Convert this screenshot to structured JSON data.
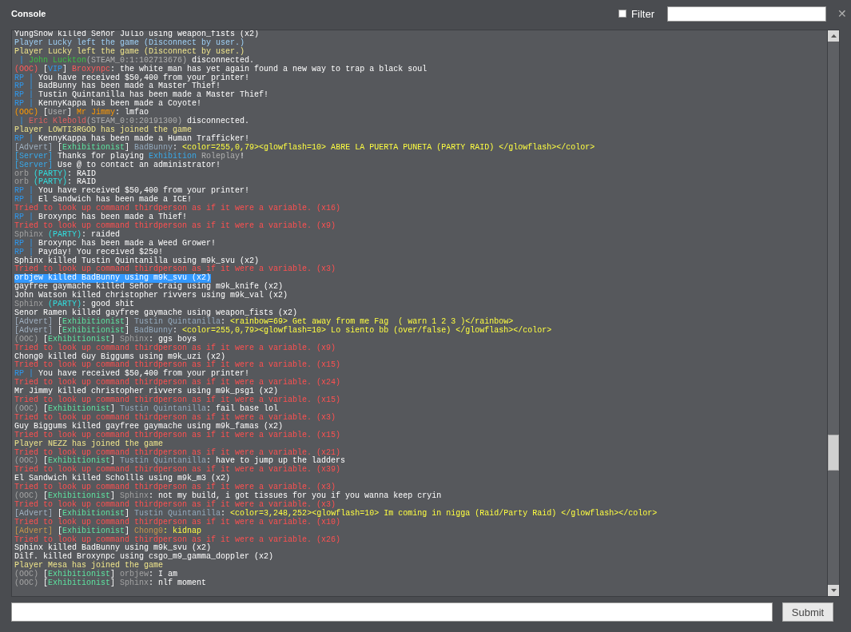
{
  "window": {
    "title": "Console",
    "close": "✕"
  },
  "filter": {
    "label": "Filter",
    "checked": false
  },
  "lines": [
    {
      "selected": false,
      "parts": [
        {
          "text": "YungSnow killed Señor Julio using weapon_fists (x2)",
          "kind": "text"
        }
      ]
    },
    {
      "selected": false,
      "parts": [
        {
          "text": "Player Lucky left the game (Disconnect by user.)",
          "kind": "left"
        }
      ]
    },
    {
      "selected": false,
      "parts": [
        {
          "text": "Player Lucky left the game (Disconnect by user.)",
          "kind": "joined"
        }
      ]
    },
    {
      "selected": false,
      "parts": [
        {
          "text": " | ",
          "kind": "rp"
        },
        {
          "text": "John Luckton",
          "kind": "player"
        },
        {
          "text": "(STEAM_0:1:102713676)",
          "kind": "id"
        },
        {
          "text": " disconnected.",
          "kind": "text"
        }
      ]
    },
    {
      "selected": false,
      "parts": [
        {
          "text": "(OOC) ",
          "kind": "ooc"
        },
        {
          "text": "[",
          "kind": "text"
        },
        {
          "text": "VIP",
          "kind": "rp"
        },
        {
          "text": "] ",
          "kind": "text"
        },
        {
          "text": "Broxynpc",
          "kind": "ooc"
        },
        {
          "text": ": the white man has yet again found a new way to trap a black soul",
          "kind": "text"
        }
      ]
    },
    {
      "selected": false,
      "parts": [
        {
          "text": "RP | ",
          "kind": "rp"
        },
        {
          "text": "You have received $50,400 from your printer!",
          "kind": "text"
        }
      ]
    },
    {
      "selected": false,
      "parts": [
        {
          "text": "RP | ",
          "kind": "rp"
        },
        {
          "text": "BadBunny has been made a Master Thief!",
          "kind": "text"
        }
      ]
    },
    {
      "selected": false,
      "parts": [
        {
          "text": "RP | ",
          "kind": "rp"
        },
        {
          "text": "Tustin Quintanilla has been made a Master Thief!",
          "kind": "text"
        }
      ]
    },
    {
      "selected": false,
      "parts": [
        {
          "text": "RP | ",
          "kind": "rp"
        },
        {
          "text": "KennyKappa has been made a Coyote!",
          "kind": "text"
        }
      ]
    },
    {
      "selected": false,
      "parts": [
        {
          "text": "(OOC) ",
          "kind": "user"
        },
        {
          "text": "[",
          "kind": "text"
        },
        {
          "text": "User",
          "kind": "id"
        },
        {
          "text": "] ",
          "kind": "text"
        },
        {
          "text": "Mr Jimmy",
          "kind": "user"
        },
        {
          "text": ": lmfao",
          "kind": "text"
        }
      ]
    },
    {
      "selected": false,
      "parts": [
        {
          "text": " | ",
          "kind": "rp"
        },
        {
          "text": "Eric Klebold",
          "kind": "leaver"
        },
        {
          "text": "(STEAM_0:0:20191300)",
          "kind": "id"
        },
        {
          "text": " disconnected.",
          "kind": "text"
        }
      ]
    },
    {
      "selected": false,
      "parts": [
        {
          "text": "Player LOWTI3RGOD has joined the game",
          "kind": "joined"
        }
      ]
    },
    {
      "selected": false,
      "parts": [
        {
          "text": "RP | ",
          "kind": "rp"
        },
        {
          "text": "KennyKappa has been made a Human Trafficker!",
          "kind": "text"
        }
      ]
    },
    {
      "selected": false,
      "parts": [
        {
          "text": "[Advert] ",
          "kind": "advert"
        },
        {
          "text": "[",
          "kind": "text"
        },
        {
          "text": "Exhibitionist",
          "kind": "group"
        },
        {
          "text": "] ",
          "kind": "text"
        },
        {
          "text": "BadBunny",
          "kind": "member"
        },
        {
          "text": ": ",
          "kind": "text"
        },
        {
          "text": "<color=255,0,79><glowflash=10> ABRE LA PUERTA PUNETA (PARTY RAID) </glowflash></color>",
          "kind": "markup"
        }
      ]
    },
    {
      "selected": false,
      "parts": [
        {
          "text": "[Server] ",
          "kind": "server"
        },
        {
          "text": "Thanks for playing ",
          "kind": "text"
        },
        {
          "text": "Exhibition",
          "kind": "server"
        },
        {
          "text": " Roleplay",
          "kind": "id"
        },
        {
          "text": "!",
          "kind": "text"
        }
      ]
    },
    {
      "selected": false,
      "parts": [
        {
          "text": "[Server] ",
          "kind": "server"
        },
        {
          "text": "Use @ to contact an administrator!",
          "kind": "text"
        }
      ]
    },
    {
      "selected": false,
      "parts": [
        {
          "text": "orb ",
          "kind": "guest"
        },
        {
          "text": "(PARTY)",
          "kind": "party"
        },
        {
          "text": ": RAID",
          "kind": "text"
        }
      ]
    },
    {
      "selected": false,
      "parts": [
        {
          "text": "orb ",
          "kind": "guest"
        },
        {
          "text": "(PARTY)",
          "kind": "party"
        },
        {
          "text": ": RAID",
          "kind": "text"
        }
      ]
    },
    {
      "selected": false,
      "parts": [
        {
          "text": "RP | ",
          "kind": "rp"
        },
        {
          "text": "You have received $50,400 from your printer!",
          "kind": "text"
        }
      ]
    },
    {
      "selected": false,
      "parts": [
        {
          "text": "RP | ",
          "kind": "rp"
        },
        {
          "text": "El Sandwich has been made a ICE!",
          "kind": "text"
        }
      ]
    },
    {
      "selected": false,
      "parts": [
        {
          "text": "Tried to look up command thirdperson as if it were a variable. (x16)",
          "kind": "error"
        }
      ]
    },
    {
      "selected": false,
      "parts": [
        {
          "text": "RP | ",
          "kind": "rp"
        },
        {
          "text": "Broxynpc has been made a Thief!",
          "kind": "text"
        }
      ]
    },
    {
      "selected": false,
      "parts": [
        {
          "text": "Tried to look up command thirdperson as if it were a variable. (x9)",
          "kind": "error"
        }
      ]
    },
    {
      "selected": false,
      "parts": [
        {
          "text": "Sphinx ",
          "kind": "guest"
        },
        {
          "text": "(PARTY)",
          "kind": "party"
        },
        {
          "text": ": raided",
          "kind": "text"
        }
      ]
    },
    {
      "selected": false,
      "parts": [
        {
          "text": "RP | ",
          "kind": "rp"
        },
        {
          "text": "Broxynpc has been made a Weed Grower!",
          "kind": "text"
        }
      ]
    },
    {
      "selected": false,
      "parts": [
        {
          "text": "RP | ",
          "kind": "rp"
        },
        {
          "text": "Payday! You received $250!",
          "kind": "text"
        }
      ]
    },
    {
      "selected": false,
      "parts": [
        {
          "text": "Sphinx killed Tustin Quintanilla using m9k_svu (x2)",
          "kind": "text"
        }
      ]
    },
    {
      "selected": false,
      "parts": [
        {
          "text": "Tried to look up command thirdperson as if it were a variable. (x3)",
          "kind": "error"
        }
      ]
    },
    {
      "selected": true,
      "parts": [
        {
          "text": "orbjew killed BadBunny using m9k_svu (x2)",
          "kind": "text"
        }
      ]
    },
    {
      "selected": false,
      "parts": [
        {
          "text": "gayfree gaymache killed Señor Craig using m9k_knife (x2)",
          "kind": "text"
        }
      ]
    },
    {
      "selected": false,
      "parts": [
        {
          "text": "John Watson killed christopher rivvers using m9k_val (x2)",
          "kind": "text"
        }
      ]
    },
    {
      "selected": false,
      "parts": [
        {
          "text": "Sphinx ",
          "kind": "guest"
        },
        {
          "text": "(PARTY)",
          "kind": "party"
        },
        {
          "text": ": good shit",
          "kind": "text"
        }
      ]
    },
    {
      "selected": false,
      "parts": [
        {
          "text": "Senor Ramen killed gayfree gaymache using weapon_fists (x2)",
          "kind": "text"
        }
      ]
    },
    {
      "selected": false,
      "parts": [
        {
          "text": "[Advert] ",
          "kind": "advert"
        },
        {
          "text": "[",
          "kind": "text"
        },
        {
          "text": "Exhibitionist",
          "kind": "group"
        },
        {
          "text": "] ",
          "kind": "text"
        },
        {
          "text": "Tustin Quintanilla",
          "kind": "member"
        },
        {
          "text": ": ",
          "kind": "text"
        },
        {
          "text": "<rainbow=69> Get away from me Fag  ( warn 1 2 3 )</rainbow>",
          "kind": "markup"
        }
      ]
    },
    {
      "selected": false,
      "parts": [
        {
          "text": "[Advert] ",
          "kind": "advert"
        },
        {
          "text": "[",
          "kind": "text"
        },
        {
          "text": "Exhibitionist",
          "kind": "group"
        },
        {
          "text": "] ",
          "kind": "text"
        },
        {
          "text": "BadBunny",
          "kind": "member"
        },
        {
          "text": ": ",
          "kind": "text"
        },
        {
          "text": "<color=255,0,79><glowflash=10> Lo siento bb (over/false) </glowflash></color>",
          "kind": "markup"
        }
      ]
    },
    {
      "selected": false,
      "parts": [
        {
          "text": "(OOC) ",
          "kind": "guest"
        },
        {
          "text": "[",
          "kind": "text"
        },
        {
          "text": "Exhibitionist",
          "kind": "group"
        },
        {
          "text": "] ",
          "kind": "text"
        },
        {
          "text": "Sphinx",
          "kind": "guest"
        },
        {
          "text": ": ggs boys",
          "kind": "text"
        }
      ]
    },
    {
      "selected": false,
      "parts": [
        {
          "text": "Tried to look up command thirdperson as if it were a variable. (x9)",
          "kind": "error"
        }
      ]
    },
    {
      "selected": false,
      "parts": [
        {
          "text": "Chong0 killed Guy Biggums using m9k_uzi (x2)",
          "kind": "text"
        }
      ]
    },
    {
      "selected": false,
      "parts": [
        {
          "text": "Tried to look up command thirdperson as if it were a variable. (x15)",
          "kind": "error"
        }
      ]
    },
    {
      "selected": false,
      "parts": [
        {
          "text": "RP | ",
          "kind": "rp"
        },
        {
          "text": "You have received $50,400 from your printer!",
          "kind": "text"
        }
      ]
    },
    {
      "selected": false,
      "parts": [
        {
          "text": "Tried to look up command thirdperson as if it were a variable. (x24)",
          "kind": "error"
        }
      ]
    },
    {
      "selected": false,
      "parts": [
        {
          "text": "Mr Jimmy killed christopher rivvers using m9k_psg1 (x2)",
          "kind": "text"
        }
      ]
    },
    {
      "selected": false,
      "parts": [
        {
          "text": "Tried to look up command thirdperson as if it were a variable. (x15)",
          "kind": "error"
        }
      ]
    },
    {
      "selected": false,
      "parts": [
        {
          "text": "(OOC) ",
          "kind": "guest"
        },
        {
          "text": "[",
          "kind": "text"
        },
        {
          "text": "Exhibitionist",
          "kind": "group"
        },
        {
          "text": "] ",
          "kind": "text"
        },
        {
          "text": "Tustin Quintanilla",
          "kind": "member"
        },
        {
          "text": ": fail base lol",
          "kind": "text"
        }
      ]
    },
    {
      "selected": false,
      "parts": [
        {
          "text": "Tried to look up command thirdperson as if it were a variable. (x3)",
          "kind": "error"
        }
      ]
    },
    {
      "selected": false,
      "parts": [
        {
          "text": "Guy Biggums killed gayfree gaymache using m9k_famas (x2)",
          "kind": "text"
        }
      ]
    },
    {
      "selected": false,
      "parts": [
        {
          "text": "Tried to look up command thirdperson as if it were a variable. (x15)",
          "kind": "error"
        }
      ]
    },
    {
      "selected": false,
      "parts": [
        {
          "text": "Player NEZZ has joined the game",
          "kind": "joined"
        }
      ]
    },
    {
      "selected": false,
      "parts": [
        {
          "text": "Tried to look up command thirdperson as if it were a variable. (x21)",
          "kind": "error"
        }
      ]
    },
    {
      "selected": false,
      "parts": [
        {
          "text": "(OOC) ",
          "kind": "guest"
        },
        {
          "text": "[",
          "kind": "text"
        },
        {
          "text": "Exhibitionist",
          "kind": "group"
        },
        {
          "text": "] ",
          "kind": "text"
        },
        {
          "text": "Tustin Quintanilla",
          "kind": "member"
        },
        {
          "text": ": have to jump up the ladders",
          "kind": "text"
        }
      ]
    },
    {
      "selected": false,
      "parts": [
        {
          "text": "Tried to look up command thirdperson as if it were a variable. (x39)",
          "kind": "error"
        }
      ]
    },
    {
      "selected": false,
      "parts": [
        {
          "text": "El Sandwich killed Schollls using m9k_m3 (x2)",
          "kind": "text"
        }
      ]
    },
    {
      "selected": false,
      "parts": [
        {
          "text": "Tried to look up command thirdperson as if it were a variable. (x3)",
          "kind": "error"
        }
      ]
    },
    {
      "selected": false,
      "parts": [
        {
          "text": "(OOC) ",
          "kind": "guest"
        },
        {
          "text": "[",
          "kind": "text"
        },
        {
          "text": "Exhibitionist",
          "kind": "group"
        },
        {
          "text": "] ",
          "kind": "text"
        },
        {
          "text": "Sphinx",
          "kind": "guest"
        },
        {
          "text": ": not my build, i got tissues for you if you wanna keep cryin",
          "kind": "text"
        }
      ]
    },
    {
      "selected": false,
      "parts": [
        {
          "text": "Tried to look up command thirdperson as if it were a variable. (x3)",
          "kind": "error"
        }
      ]
    },
    {
      "selected": false,
      "parts": [
        {
          "text": "[Advert] ",
          "kind": "advert"
        },
        {
          "text": "[",
          "kind": "text"
        },
        {
          "text": "Exhibitionist",
          "kind": "group"
        },
        {
          "text": "] ",
          "kind": "text"
        },
        {
          "text": "Tustin Quintanilla",
          "kind": "member"
        },
        {
          "text": ": ",
          "kind": "text"
        },
        {
          "text": "<color=3,248,252><glowflash=10> Im coming in nigga (Raid/Party Raid) </glowflash></color>",
          "kind": "markup"
        }
      ]
    },
    {
      "selected": false,
      "parts": [
        {
          "text": "Tried to look up command thirdperson as if it were a variable. (x10)",
          "kind": "error"
        }
      ]
    },
    {
      "selected": false,
      "parts": [
        {
          "text": "[Advert] ",
          "kind": "donor"
        },
        {
          "text": "[",
          "kind": "text"
        },
        {
          "text": "Exhibitionist",
          "kind": "group"
        },
        {
          "text": "] ",
          "kind": "text"
        },
        {
          "text": "Chong0",
          "kind": "donor"
        },
        {
          "text": ": kidnap",
          "kind": "markup"
        }
      ]
    },
    {
      "selected": false,
      "parts": [
        {
          "text": "Tried to look up command thirdperson as if it were a variable. (x26)",
          "kind": "error"
        }
      ]
    },
    {
      "selected": false,
      "parts": [
        {
          "text": "Sphinx killed BadBunny using m9k_svu (x2)",
          "kind": "text"
        }
      ]
    },
    {
      "selected": false,
      "parts": [
        {
          "text": "Dilf. killed Broxynpc using csgo_m9_gamma_doppler (x2)",
          "kind": "text"
        }
      ]
    },
    {
      "selected": false,
      "parts": [
        {
          "text": "Player Mesa has joined the game",
          "kind": "joined"
        }
      ]
    },
    {
      "selected": false,
      "parts": [
        {
          "text": "(OOC) ",
          "kind": "guest"
        },
        {
          "text": "[",
          "kind": "text"
        },
        {
          "text": "Exhibitionist",
          "kind": "group"
        },
        {
          "text": "] ",
          "kind": "text"
        },
        {
          "text": "orbjew",
          "kind": "guest"
        },
        {
          "text": ": I am",
          "kind": "text"
        }
      ]
    },
    {
      "selected": false,
      "parts": [
        {
          "text": "(OOC) ",
          "kind": "guest"
        },
        {
          "text": "[",
          "kind": "text"
        },
        {
          "text": "Exhibitionist",
          "kind": "group"
        },
        {
          "text": "] ",
          "kind": "text"
        },
        {
          "text": "Sphinx",
          "kind": "guest"
        },
        {
          "text": ": nlf moment",
          "kind": "text"
        }
      ]
    }
  ],
  "submit": "Submit"
}
